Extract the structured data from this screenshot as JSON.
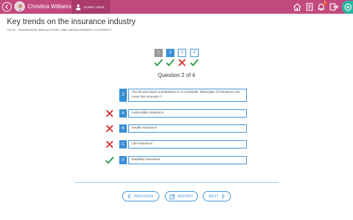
{
  "header": {
    "user_name": "Christina Williams",
    "admin_view_label": "ADMIN VIEW",
    "notification_count": "1"
  },
  "page": {
    "title": "Key trends on the insurance industry",
    "subtitle": "ACTS - INSURANCE REGULATORY AND DEVELOPMENT AUTHORITY"
  },
  "question_nav": [
    {
      "label": "1",
      "state": "visited",
      "result": "correct"
    },
    {
      "label": "2",
      "state": "current",
      "result": "correct"
    },
    {
      "label": "3",
      "state": "default",
      "result": "wrong"
    },
    {
      "label": "4",
      "state": "default",
      "result": "correct"
    }
  ],
  "question": {
    "counter": "Question 2 of 4",
    "number": "2",
    "text": "You hit and injure a pedestrian in a crosswalk. What type of insurance can cover this scenario ?",
    "options": [
      {
        "letter": "A",
        "text": "Automobile Insurance",
        "result": "wrong"
      },
      {
        "letter": "B",
        "text": "Health Insurance",
        "result": "wrong"
      },
      {
        "letter": "C",
        "text": "Life Insurance",
        "result": "wrong"
      },
      {
        "letter": "D",
        "text": "Disability Insurance",
        "result": "correct"
      }
    ]
  },
  "footer": {
    "previous_label": "PREVIOUS",
    "report_label": "REPORT",
    "next_label": "NEXT"
  },
  "colors": {
    "topbar": "#c2497e",
    "accent": "#3a8fd6",
    "correct": "#2a9d4a",
    "wrong": "#d63a3a"
  },
  "icons": {
    "back": "back-arrow-icon",
    "admin": "admin-icon",
    "home": "home-icon",
    "document": "document-icon",
    "notifications": "bell-icon",
    "logout": "logout-icon",
    "previous": "chevron-left-icon",
    "report": "edit-icon",
    "next": "chevron-right-icon",
    "correct": "checkmark-icon",
    "wrong": "cross-icon"
  }
}
